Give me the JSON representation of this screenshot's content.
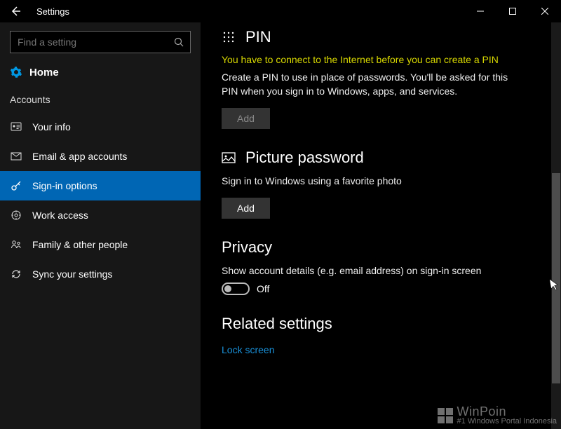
{
  "window": {
    "title": "Settings"
  },
  "search": {
    "placeholder": "Find a setting"
  },
  "home_label": "Home",
  "section_label": "Accounts",
  "nav": [
    {
      "label": "Your info"
    },
    {
      "label": "Email & app accounts"
    },
    {
      "label": "Sign-in options"
    },
    {
      "label": "Work access"
    },
    {
      "label": "Family & other people"
    },
    {
      "label": "Sync your settings"
    }
  ],
  "pin": {
    "heading": "PIN",
    "warning": "You have to connect to the Internet before you can create a PIN",
    "desc": "Create a PIN to use in place of passwords. You'll be asked for this PIN when you sign in to Windows, apps, and services.",
    "button": "Add"
  },
  "picture": {
    "heading": "Picture password",
    "desc": "Sign in to Windows using a favorite photo",
    "button": "Add"
  },
  "privacy": {
    "heading": "Privacy",
    "desc": "Show account details (e.g. email address) on sign-in screen",
    "toggle_state": "Off"
  },
  "related": {
    "heading": "Related settings",
    "link": "Lock screen"
  },
  "watermark": {
    "name": "WinPoin",
    "tagline": "#1 Windows Portal Indonesia"
  }
}
